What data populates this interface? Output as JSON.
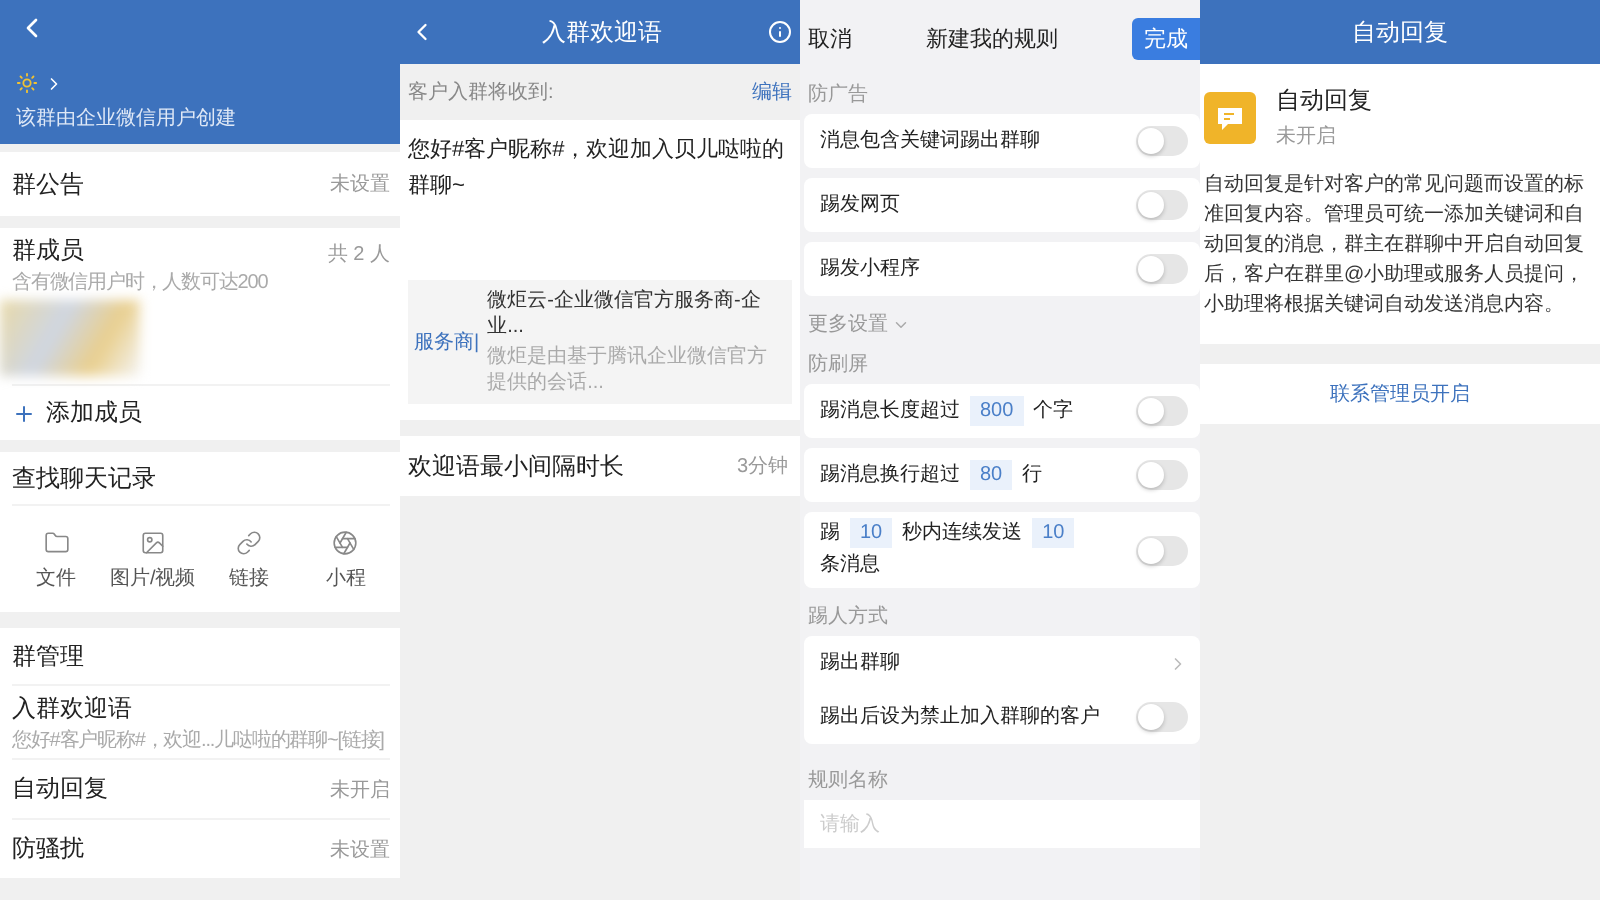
{
  "group_info": {
    "header_subtitle": "该群由企业微信用户创建",
    "announcement": {
      "label": "群公告",
      "value": "未设置"
    },
    "members": {
      "label": "群成员",
      "note": "含有微信用户时，人数可达200",
      "count": "共 2 人",
      "add_label": "添加成员"
    },
    "history": {
      "label": "查找聊天记录",
      "categories": [
        {
          "kind": "file",
          "label": "文件"
        },
        {
          "kind": "image",
          "label": "图片/视频"
        },
        {
          "kind": "link",
          "label": "链接"
        },
        {
          "kind": "miniapp",
          "label": "小程"
        }
      ]
    },
    "management": {
      "title": "群管理",
      "items": [
        {
          "label": "入群欢迎语",
          "subtitle": "您好#客户昵称#，欢迎...儿哒啦的群聊~[链接]"
        },
        {
          "label": "自动回复",
          "value": "未开启"
        },
        {
          "label": "防骚扰",
          "value": "未设置"
        }
      ]
    }
  },
  "welcome_message": {
    "title": "入群欢迎语",
    "caption": "客户入群将收到:",
    "edit": "编辑",
    "message": "您好#客户昵称#，欢迎加入贝儿哒啦的群聊~",
    "link_card": {
      "tag": "服务商|",
      "title": "微炬云-企业微信官方服务商-企业...",
      "description": "微炬是由基于腾讯企业微信官方提供的会话..."
    },
    "interval": {
      "label": "欢迎语最小间隔时长",
      "value": "3分钟"
    }
  },
  "new_rule": {
    "cancel": "取消",
    "title": "新建我的规则",
    "done": "完成",
    "sections": [
      {
        "kind": "cards",
        "title": "防广告",
        "rows": [
          {
            "kind": "toggle",
            "on": false,
            "segments": [
              {
                "kind": "text",
                "text": "消息包含关键词踢出群聊"
              }
            ]
          },
          {
            "kind": "toggle",
            "on": false,
            "segments": [
              {
                "kind": "text",
                "text": "踢发网页"
              }
            ]
          },
          {
            "kind": "toggle",
            "on": false,
            "segments": [
              {
                "kind": "text",
                "text": "踢发小程序"
              }
            ]
          }
        ]
      },
      {
        "kind": "more",
        "title": "更多设置"
      },
      {
        "kind": "cards",
        "title": "防刷屏",
        "rows": [
          {
            "kind": "toggle",
            "on": false,
            "segments": [
              {
                "kind": "text",
                "text": "踢消息长度超过"
              },
              {
                "kind": "number",
                "text": "800"
              },
              {
                "kind": "text",
                "text": "个字"
              }
            ]
          },
          {
            "kind": "toggle",
            "on": false,
            "segments": [
              {
                "kind": "text",
                "text": "踢消息换行超过"
              },
              {
                "kind": "number",
                "text": "80"
              },
              {
                "kind": "text",
                "text": "行"
              }
            ]
          },
          {
            "kind": "toggle",
            "on": false,
            "segments": [
              {
                "kind": "text",
                "text": "踢"
              },
              {
                "kind": "number",
                "text": "10"
              },
              {
                "kind": "text",
                "text": "秒内连续发送"
              },
              {
                "kind": "number",
                "text": "10"
              },
              {
                "kind": "text",
                "text": "条消息"
              }
            ]
          }
        ]
      },
      {
        "kind": "group",
        "title": "踢人方式",
        "rows": [
          {
            "kind": "nav",
            "segments": [
              {
                "kind": "text",
                "text": "踢出群聊"
              }
            ]
          },
          {
            "kind": "toggle",
            "on": false,
            "segments": [
              {
                "kind": "text",
                "text": "踢出后设为禁止加入群聊的客户"
              }
            ]
          }
        ]
      },
      {
        "kind": "input",
        "title": "规则名称",
        "placeholder": "请输入"
      }
    ]
  },
  "auto_reply": {
    "title": "自动回复",
    "feature": {
      "name": "自动回复",
      "status": "未开启"
    },
    "description": "自动回复是针对客户的常见问题而设置的标准回复内容。管理员可统一添加关键词和自动回复的消息，群主在群聊中开启自动回复后，客户在群里@小助理或服务人员提问，小助理将根据关键词自动发送消息内容。",
    "action": "联系管理员开启"
  }
}
